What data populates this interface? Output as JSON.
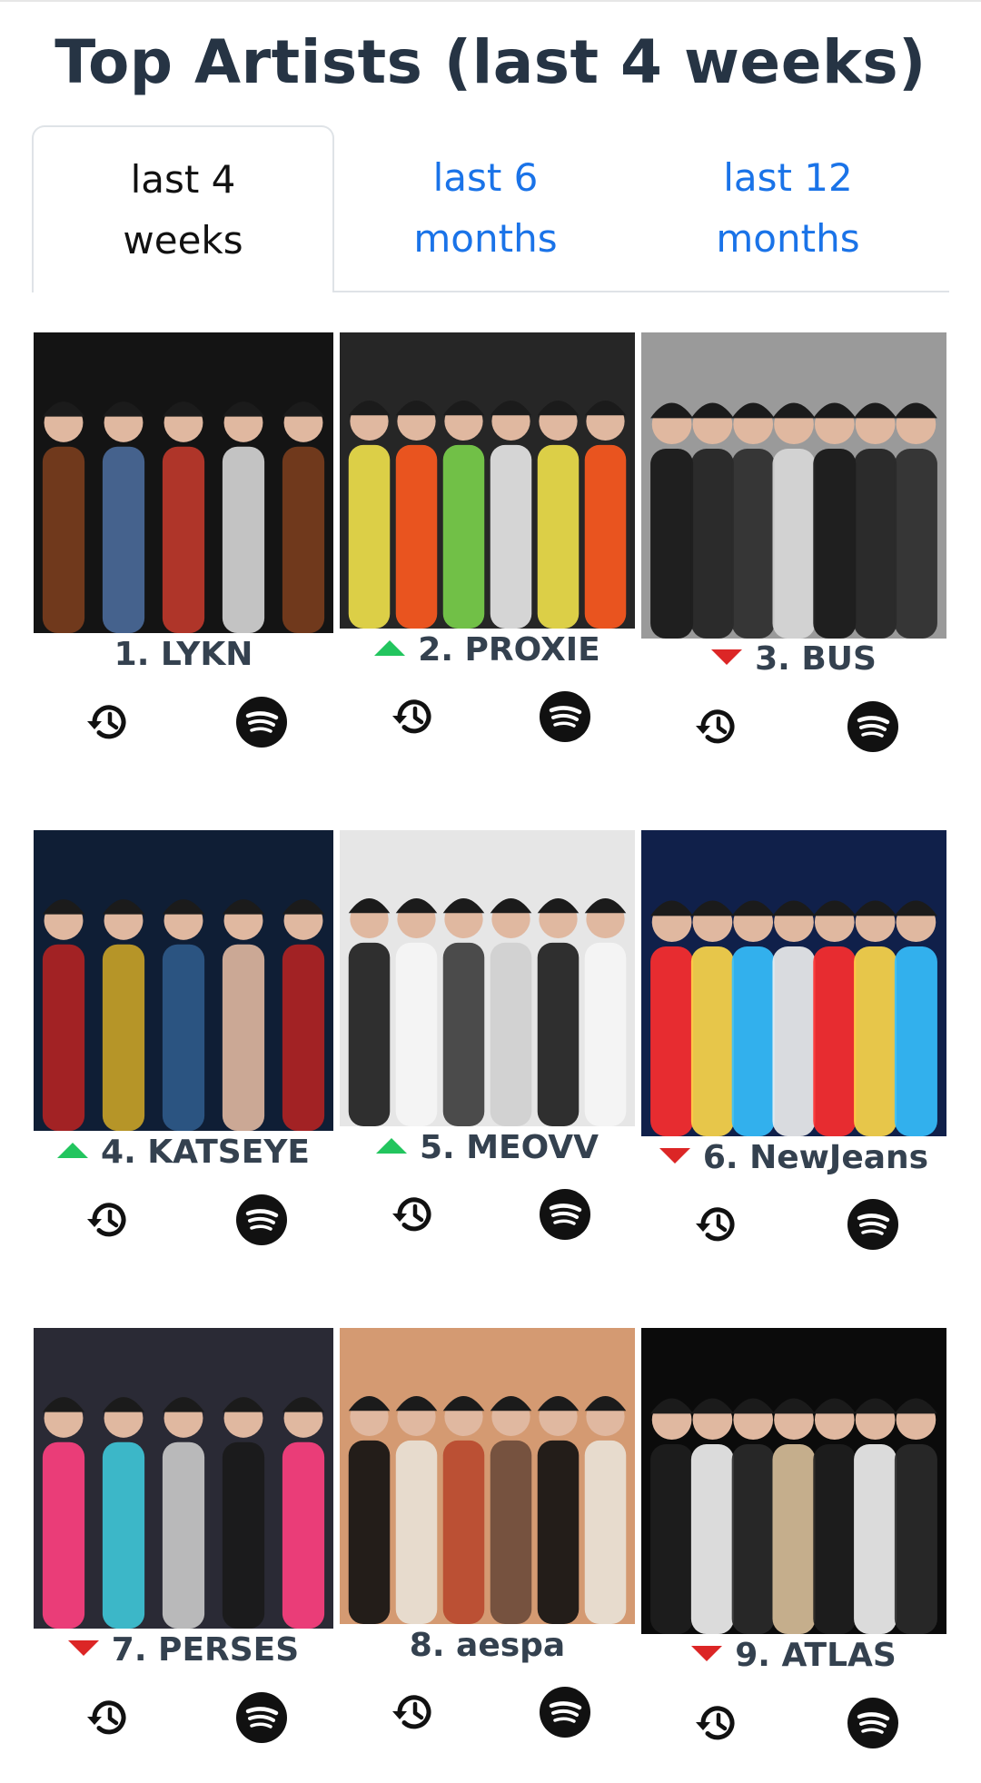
{
  "page": {
    "title": "Top Artists (last 4 weeks)"
  },
  "tabs": [
    {
      "label": "last 4\nweeks",
      "active": true
    },
    {
      "label": "last 6\nmonths",
      "active": false
    },
    {
      "label": "last 12\nmonths",
      "active": false
    }
  ],
  "artists": [
    {
      "rank_name": "1. LYKN",
      "trend": "none",
      "history_icon": "history-icon",
      "spotify_icon": "spotify-icon"
    },
    {
      "rank_name": "2. PROXIE",
      "trend": "up",
      "history_icon": "history-icon",
      "spotify_icon": "spotify-icon"
    },
    {
      "rank_name": "3. BUS",
      "trend": "down",
      "history_icon": "history-icon",
      "spotify_icon": "spotify-icon"
    },
    {
      "rank_name": "4. KATSEYE",
      "trend": "up",
      "history_icon": "history-icon",
      "spotify_icon": "spotify-icon"
    },
    {
      "rank_name": "5. MEOVV",
      "trend": "up",
      "history_icon": "history-icon",
      "spotify_icon": "spotify-icon"
    },
    {
      "rank_name": "6. NewJeans",
      "trend": "down",
      "history_icon": "history-icon",
      "spotify_icon": "spotify-icon"
    },
    {
      "rank_name": "7. PERSES",
      "trend": "down",
      "history_icon": "history-icon",
      "spotify_icon": "spotify-icon"
    },
    {
      "rank_name": "8. aespa",
      "trend": "none",
      "history_icon": "history-icon",
      "spotify_icon": "spotify-icon"
    },
    {
      "rank_name": "9. ATLAS",
      "trend": "down",
      "history_icon": "history-icon",
      "spotify_icon": "spotify-icon"
    }
  ],
  "colors": {
    "title": "#263444",
    "link": "#1a73e8",
    "up": "#22c55e",
    "down": "#dc2626"
  }
}
